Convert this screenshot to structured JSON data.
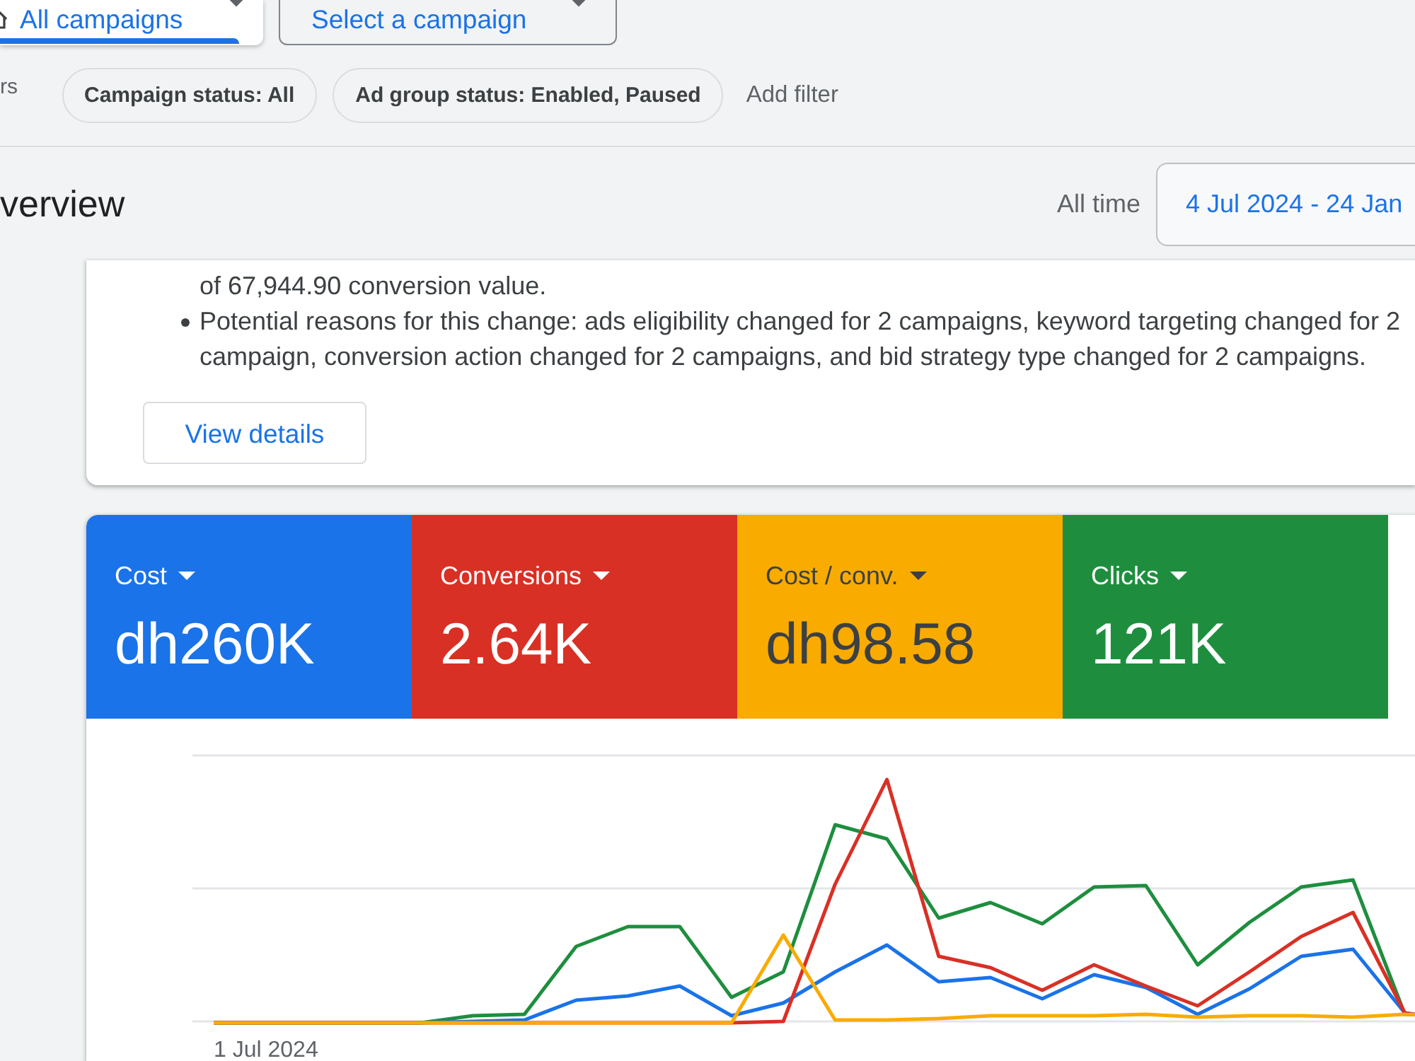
{
  "scope_selectors": [
    {
      "kind": "all",
      "label": "All campaigns",
      "selected": true
    },
    {
      "kind": "single",
      "label": "Select a campaign",
      "selected": false
    }
  ],
  "filters": {
    "label": "rs",
    "chips": [
      "Campaign status: All",
      "Ad group status: Enabled, Paused"
    ],
    "add_filter": "Add filter"
  },
  "header": {
    "title": "verview",
    "range_label": "All time",
    "date_range": "4 Jul 2024 - 24 Jan"
  },
  "insight_card": {
    "continued_text": "of 67,944.90 conversion value.",
    "bullets": [
      {
        "lines": [
          "Potential reasons for this change: ads eligibility changed for 2 campaigns, keyword targeting changed for 2",
          "campaign, conversion action changed for 2 campaigns, and bid strategy type changed for 2 campaigns."
        ]
      }
    ],
    "button": "View details"
  },
  "metrics": [
    {
      "label": "Cost",
      "value": "dh260K",
      "color": "#1a73e8"
    },
    {
      "label": "Conversions",
      "value": "2.64K",
      "color": "#d93025"
    },
    {
      "label": "Cost / conv.",
      "value": "dh98.58",
      "color": "#f9ab00"
    },
    {
      "label": "Clicks",
      "value": "121K",
      "color": "#1e8e3e"
    }
  ],
  "chart": {
    "x_label": "1 Jul 2024"
  }
}
